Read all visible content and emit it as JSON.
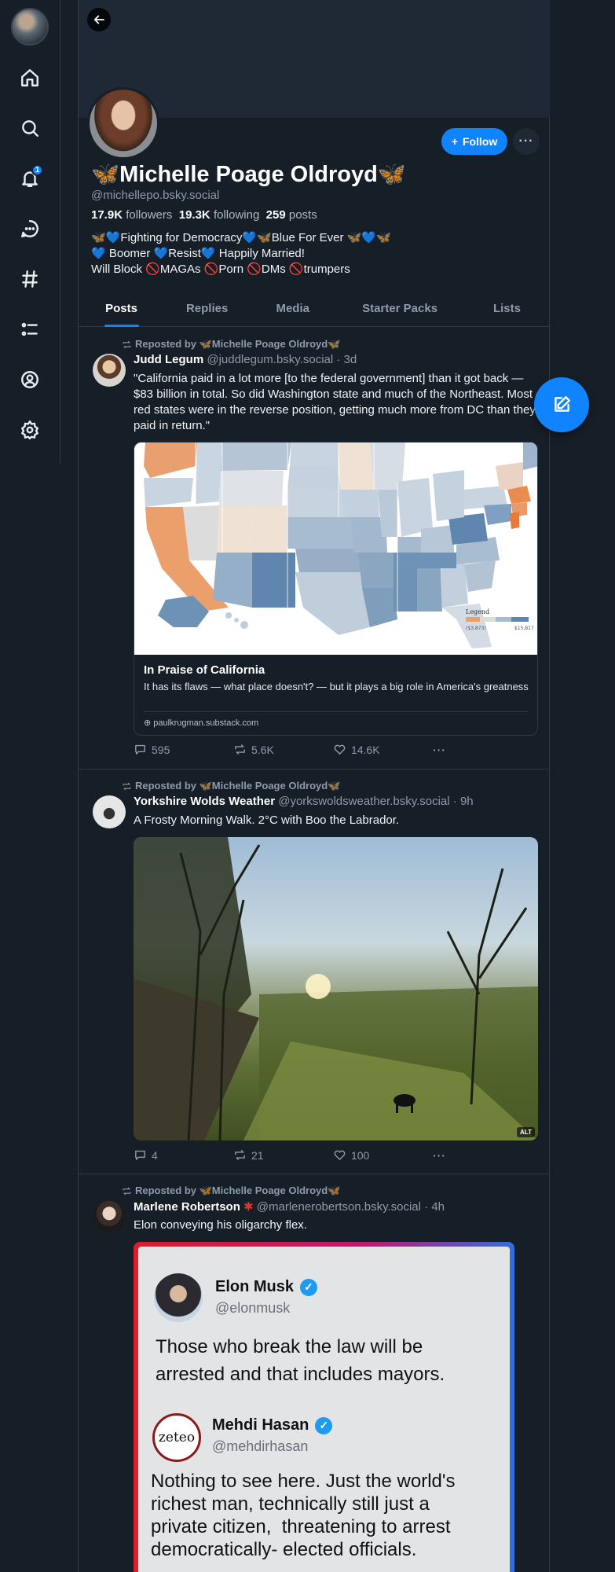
{
  "profile": {
    "display_name": "🦋Michelle Poage Oldroyd🦋",
    "handle": "@michellepo.bsky.social",
    "followers_count": "17.9K",
    "followers_label": "followers",
    "following_count": "19.3K",
    "following_label": "following",
    "posts_count": "259",
    "posts_label": "posts",
    "bio_lines": [
      "🦋💙Fighting for Democracy💙🦋Blue For Ever 🦋💙🦋",
      "💙 Boomer 💙Resist💙 Happily Married!",
      "Will Block 🚫MAGAs 🚫Porn 🚫DMs 🚫trumpers"
    ],
    "follow_label": "Follow",
    "more_label": "···"
  },
  "nav": {
    "notification_count": "1"
  },
  "tabs": [
    "Posts",
    "Replies",
    "Media",
    "Starter Packs",
    "Lists"
  ],
  "posts": [
    {
      "repost_label": "Reposted by 🦋Michelle Poage Oldroyd🦋",
      "author": "Judd Legum",
      "handle": "@juddlegum.bsky.social",
      "time": "· 3d",
      "text": "\"California paid in a lot more [to the federal government] than it got back — $83 billion in total. So did Washington state and much of the Northeast. Most red states were in the reverse position, getting much more from DC than they paid in return.\"",
      "card": {
        "title": "In Praise of California",
        "description": "It has its flaws — what place doesn't? — but it plays a big role in America's greatness",
        "domain": "paulkrugman.substack.com",
        "map_legend_title": "Legend",
        "map_legend_min": "($3,873)",
        "map_legend_max": "$15,817"
      },
      "replies": "595",
      "reposts": "5.6K",
      "likes": "14.6K"
    },
    {
      "repost_label": "Reposted by 🦋Michelle Poage Oldroyd🦋",
      "author": "Yorkshire Wolds Weather",
      "handle": "@yorkswoldsweather.bsky.social",
      "time": "· 9h",
      "text": "A Frosty Morning Walk. 2°C with Boo the Labrador.",
      "alt_label": "ALT",
      "replies": "4",
      "reposts": "21",
      "likes": "100"
    },
    {
      "repost_label": "Reposted by 🦋Michelle Poage Oldroyd🦋",
      "author": "Marlene Robertson",
      "author_badge": "✱",
      "handle": "@marlenerobertson.bsky.social",
      "time": "· 4h",
      "text": "Elon conveying his oligarchy flex.",
      "quote": {
        "name1": "Elon Musk",
        "handle1": "@elonmusk",
        "text1_line1": "Those who break the law will be",
        "text1_line2": "arrested and that includes mayors.",
        "name2": "Mehdi Hasan",
        "handle2": "@mehdirhasan",
        "avatar2_text": "zeteo",
        "text2_line1": "Nothing to see here. Just the world's",
        "text2_line2": "richest man, technically still just a",
        "text2_line3": "private citizen,  threatening to arrest",
        "text2_line4": "democratically- elected officials."
      }
    }
  ],
  "colors": {
    "accent": "#1083fe",
    "background": "#161e27",
    "border": "#2e3a48",
    "muted_text": "#8e9bab"
  }
}
